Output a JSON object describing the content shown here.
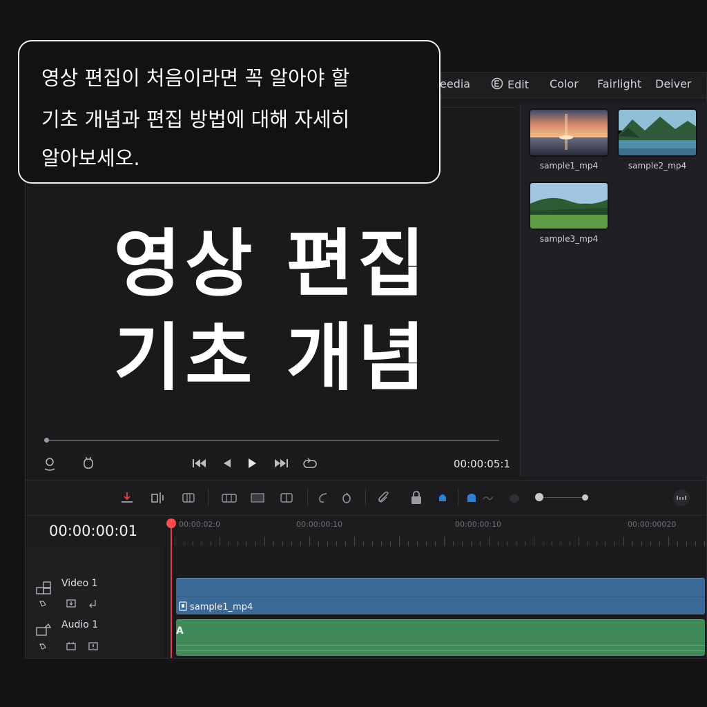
{
  "nav": {
    "media": "eedia",
    "edit": "Edit",
    "color": "Color",
    "fairlight": "Fairlight",
    "deliver": "Deiver"
  },
  "callout": {
    "line1": "영상 편집이 처음이라면 꼭 알아야 할",
    "line2": "기초 개념과 편집 방법에 대해 자세히",
    "line3": "알아보세오."
  },
  "headline": {
    "line1": "영상 편집",
    "line2": "기초 개념"
  },
  "viewer": {
    "timecode": "00:00:05:1",
    "progress": 0.0
  },
  "media_pool": {
    "items": [
      {
        "label": "sample1_mp4"
      },
      {
        "label": "sample2_mp4"
      },
      {
        "label": "sample3_mp4"
      }
    ]
  },
  "timeline": {
    "timecode": "00:00:00:01",
    "ruler": [
      "00:00:02:0",
      "00:00:00:10",
      "00:00:00:10",
      "00:00:00020"
    ],
    "tracks": {
      "video": {
        "name": "Video 1",
        "clip": "sample1_mp4"
      },
      "audio": {
        "name": "Audio 1",
        "clip": "A"
      }
    }
  },
  "colors": {
    "accent_red": "#e04040",
    "video_clip": "#3b6a98",
    "audio_clip": "#3f8a58"
  }
}
